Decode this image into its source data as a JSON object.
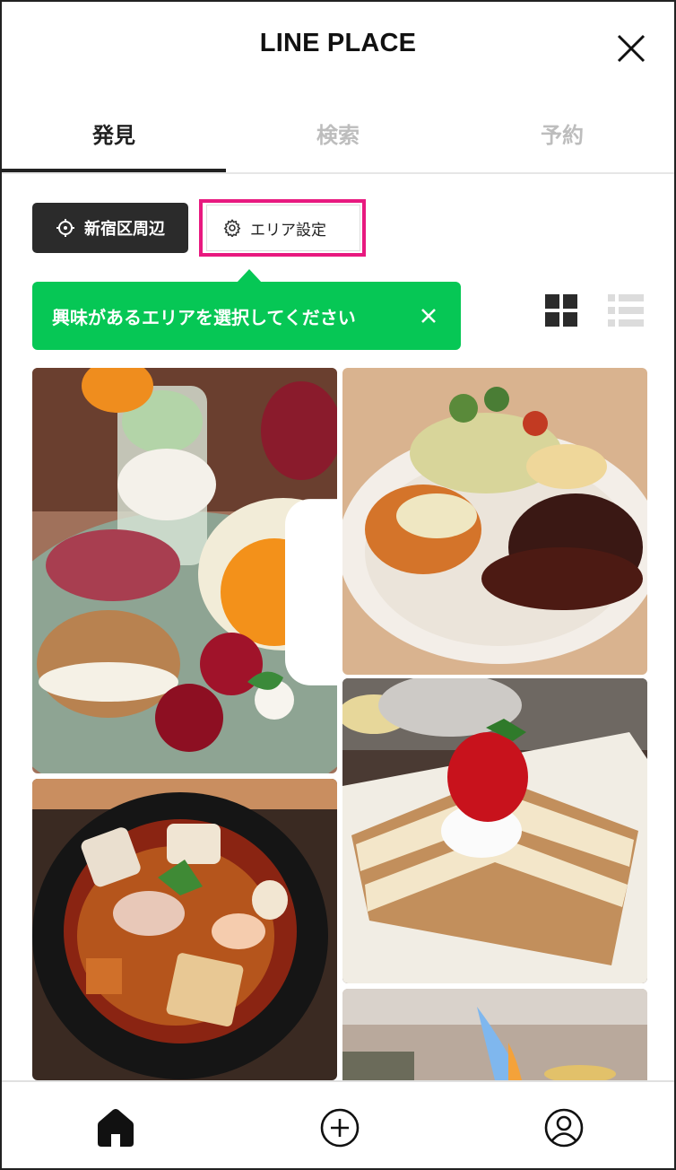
{
  "header": {
    "title": "LINE PLACE",
    "close_icon": "close-icon"
  },
  "tabs": [
    {
      "label": "発見",
      "active": true
    },
    {
      "label": "検索",
      "active": false
    },
    {
      "label": "予約",
      "active": false
    }
  ],
  "filters": {
    "area_label": "新宿区周辺",
    "area_icon": "location-target-icon",
    "setting_label": "エリア設定",
    "setting_icon": "gear-icon"
  },
  "tooltip": {
    "text": "興味があるエリアを選択してください",
    "color": "#06c755"
  },
  "view_toggle": {
    "grid_icon": "grid-view-icon",
    "list_icon": "list-view-icon",
    "selected": "grid"
  },
  "photos": [
    {
      "subject": "parfait and scone dessert plate",
      "video": true
    },
    {
      "subject": "croquette and hamburg steak plate",
      "video": false
    },
    {
      "subject": "soba noodle bowl",
      "video": false
    },
    {
      "subject": "strawberry mille-feuille cake",
      "video": false
    },
    {
      "subject": "flambé dish",
      "video": true
    }
  ],
  "bottom_nav": [
    {
      "icon": "home-icon",
      "active": true
    },
    {
      "icon": "plus-circle-icon",
      "active": false
    },
    {
      "icon": "profile-icon",
      "active": false
    }
  ],
  "colors": {
    "accent_green": "#06c755",
    "highlight_pink": "#e8197f",
    "dark_button": "#2b2b2b"
  }
}
